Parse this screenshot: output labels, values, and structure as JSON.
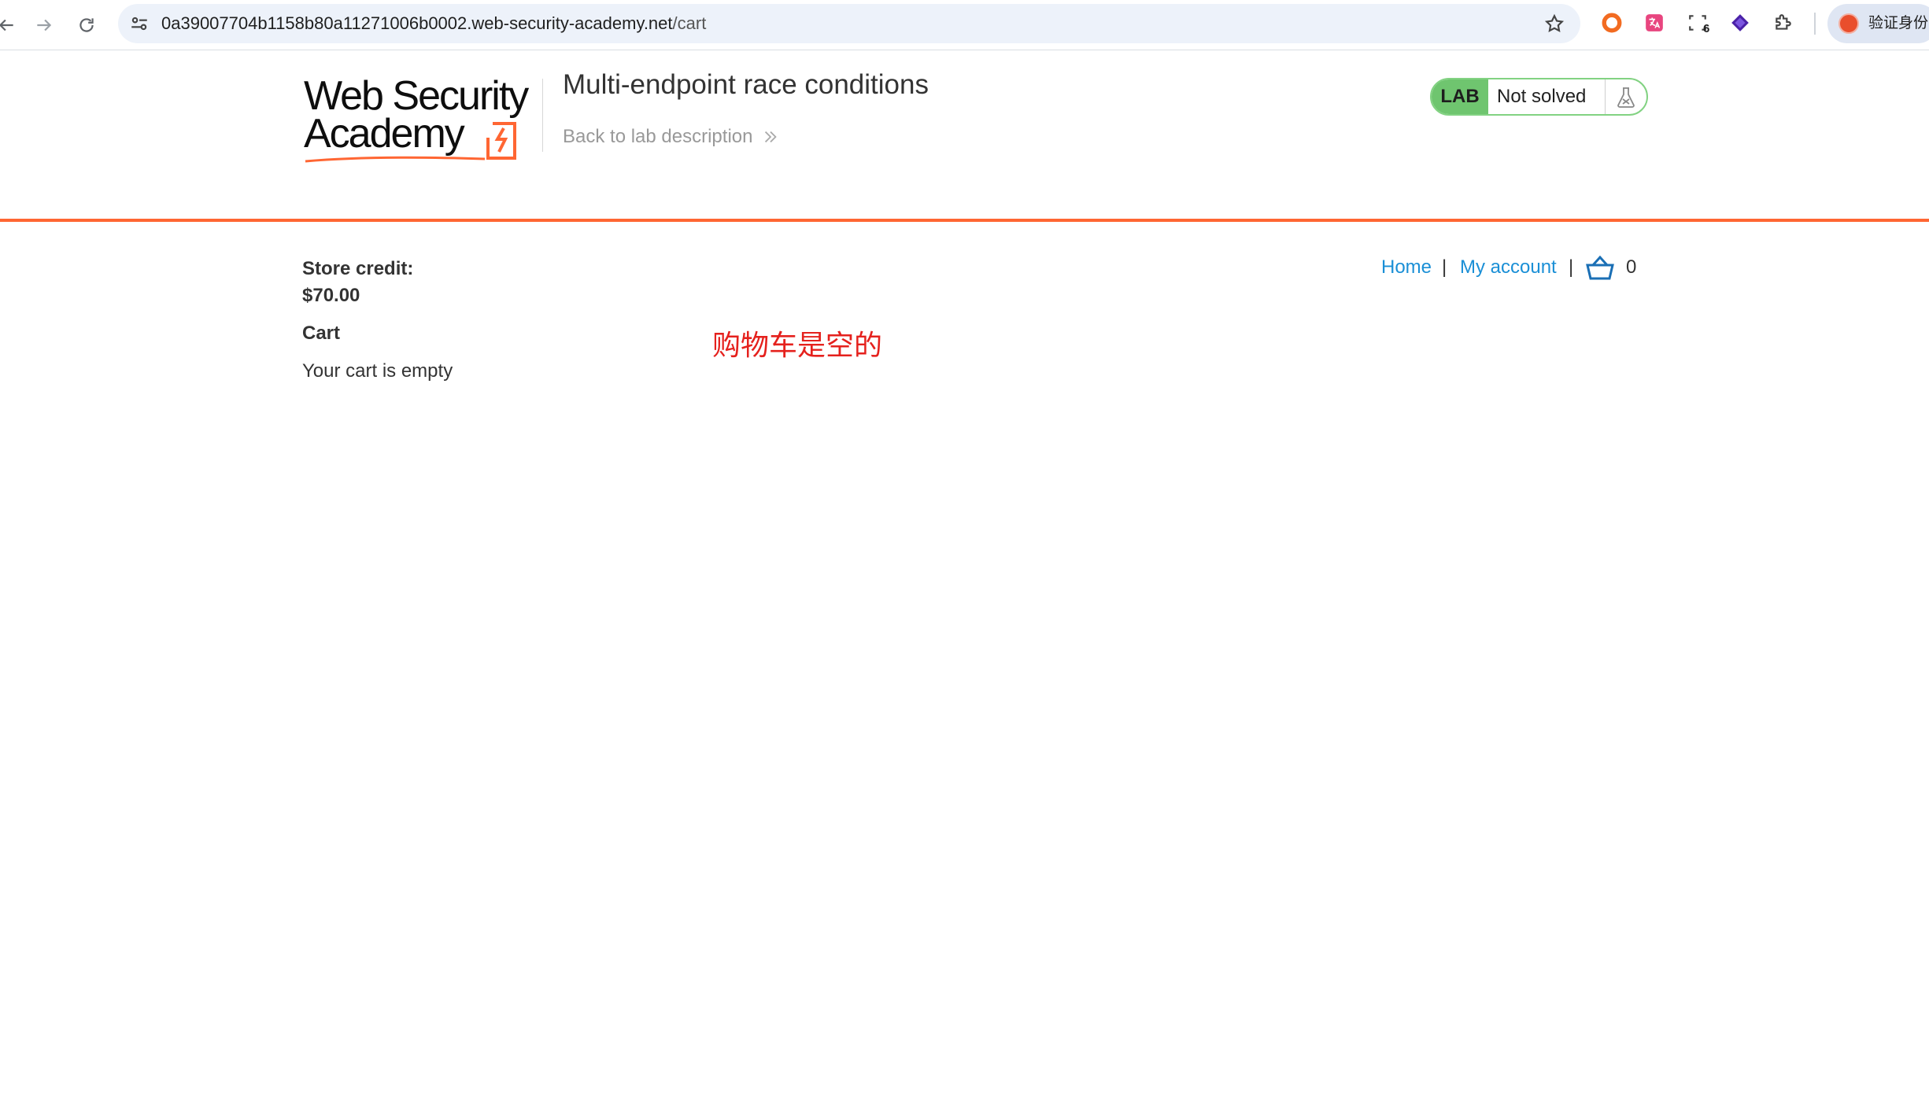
{
  "browser": {
    "url_host": "0a39007704b1158b80a11271006b0002.web-security-academy.net",
    "url_path": "/cart",
    "extension_badge": "6",
    "profile_label": "验证身份"
  },
  "header": {
    "logo_line1": "Web Security",
    "logo_line2": "Academy",
    "lab_title": "Multi-endpoint race conditions",
    "back_link": "Back to lab description",
    "lab_tag": "LAB",
    "lab_status": "Not solved"
  },
  "nav": {
    "home": "Home",
    "separator": "|",
    "my_account": "My account",
    "cart_count": "0"
  },
  "content": {
    "store_credit_label": "Store credit:",
    "store_credit_value": "$70.00",
    "cart_heading": "Cart",
    "cart_empty": "Your cart is empty",
    "annotation": "购物车是空的"
  },
  "colors": {
    "accent_orange": "#ff6633",
    "lab_green": "#6fc56f",
    "link_blue": "#1a8fd6",
    "annotation_red": "#e5211d"
  }
}
